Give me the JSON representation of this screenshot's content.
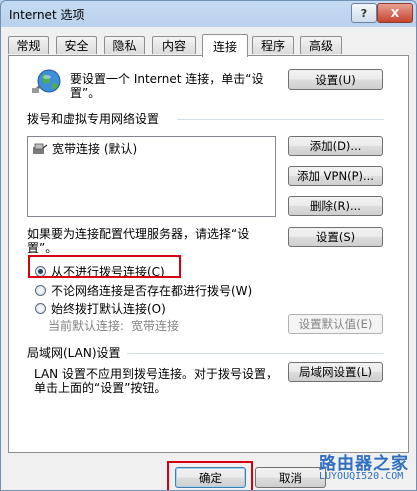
{
  "window": {
    "title": "Internet 选项"
  },
  "titlebar": {
    "help": "?",
    "close": "X"
  },
  "tabs": [
    {
      "label": "常规"
    },
    {
      "label": "安全"
    },
    {
      "label": "隐私"
    },
    {
      "label": "内容"
    },
    {
      "label": "连接"
    },
    {
      "label": "程序"
    },
    {
      "label": "高级"
    }
  ],
  "active_tab": "连接",
  "setup": {
    "text": "要设置一个 Internet 连接，单击“设置”。",
    "button": "设置(U)"
  },
  "dialup": {
    "heading": "拨号和虚拟专用网络设置",
    "items": [
      {
        "label": "宽带连接 (默认)"
      }
    ],
    "add_button": "添加(D)...",
    "add_vpn_button": "添加 VPN(P)...",
    "remove_button": "删除(R)...",
    "proxy_text": "如果要为连接配置代理服务器，请选择“设置”。",
    "settings_button": "设置(S)",
    "options": [
      {
        "label": "从不进行拨号连接(C)",
        "checked": true
      },
      {
        "label": "不论网络连接是否存在都进行拨号(W)",
        "checked": false
      },
      {
        "label": "始终拨打默认连接(O)",
        "checked": false
      }
    ],
    "current_default_label": "当前默认连接:",
    "current_default_value": "宽带连接",
    "set_default_button": "设置默认值(E)"
  },
  "lan": {
    "heading": "局域网(LAN)设置",
    "text": "LAN 设置不应用到拨号连接。对于拨号设置，单击上面的“设置”按钮。",
    "button": "局域网设置(L)"
  },
  "footer": {
    "ok": "确定",
    "cancel": "取消"
  },
  "watermark": {
    "line1": "路由器之家",
    "line2": "LUYOUQI520.COM"
  },
  "colors": {
    "highlight": "#d8000f",
    "accent": "#3b6ea5"
  }
}
